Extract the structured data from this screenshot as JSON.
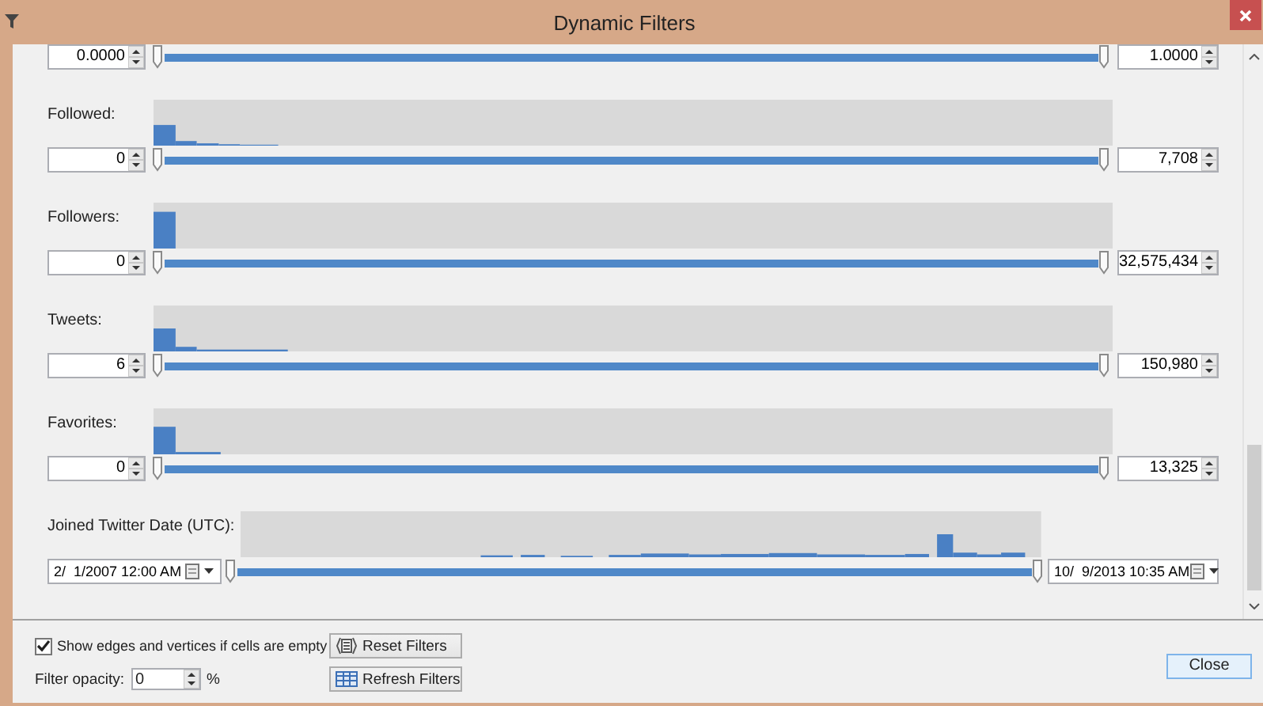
{
  "window": {
    "title": "Dynamic Filters"
  },
  "clipped_filter": {
    "min": "0.0000",
    "max": "1.0000",
    "level": 1
  },
  "filters": [
    {
      "kind": "number",
      "label": "Followed:",
      "min": "0",
      "max": "7,708",
      "level": 1
    },
    {
      "kind": "number",
      "label": "Followers:",
      "min": "0",
      "max": "32,575,434",
      "level": 1
    },
    {
      "kind": "number",
      "label": "Tweets:",
      "min": "6",
      "max": "150,980",
      "level": 1
    },
    {
      "kind": "number",
      "label": "Favorites:",
      "min": "0",
      "max": "13,325",
      "level": 1
    },
    {
      "kind": "date",
      "label": "Joined Twitter Date (UTC):",
      "min": "2/  1/2007 12:00 AM",
      "max": "10/  9/2013 10:35 AM",
      "level": 1
    }
  ],
  "show_empty": {
    "label": "Show edges and vertices if cells are empty",
    "checked": true
  },
  "opacity": {
    "label": "Filter opacity:",
    "value": "0",
    "unit": "%"
  },
  "buttons": [
    {
      "kind": "reset",
      "label": "Reset Filters"
    },
    {
      "kind": "refresh",
      "label": "Refresh Filters"
    }
  ],
  "close_button": {
    "label": "Close"
  }
}
